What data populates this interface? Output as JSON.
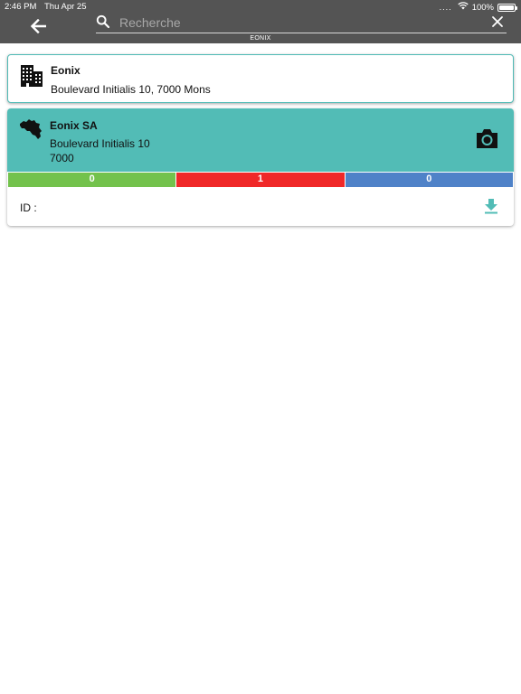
{
  "status_bar": {
    "time": "2:46 PM",
    "date": "Thu Apr 25",
    "signal": "....",
    "battery": "100%"
  },
  "header": {
    "back_icon": "arrow-left-icon",
    "subtitle": "EONIX",
    "background": "#545454"
  },
  "search": {
    "placeholder": "Recherche",
    "value": "",
    "icon": "search-icon",
    "clear_icon": "close-icon"
  },
  "results": [
    {
      "icon": "building-icon",
      "title": "Eonix",
      "address": "Boulevard Initialis 10, 7000 Mons"
    },
    {
      "icon": "belgium-map-icon",
      "title": "Eonix SA",
      "address_line1": "Boulevard Initialis 10",
      "address_line2": "7000",
      "camera_icon": "camera-icon",
      "counters": [
        {
          "value": "0",
          "color": "#73c24c"
        },
        {
          "value": "1",
          "color": "#f02828"
        },
        {
          "value": "0",
          "color": "#4f82c8"
        }
      ],
      "id_label": "ID :",
      "download_icon": "download-icon",
      "accent": "#52bcb6"
    }
  ]
}
